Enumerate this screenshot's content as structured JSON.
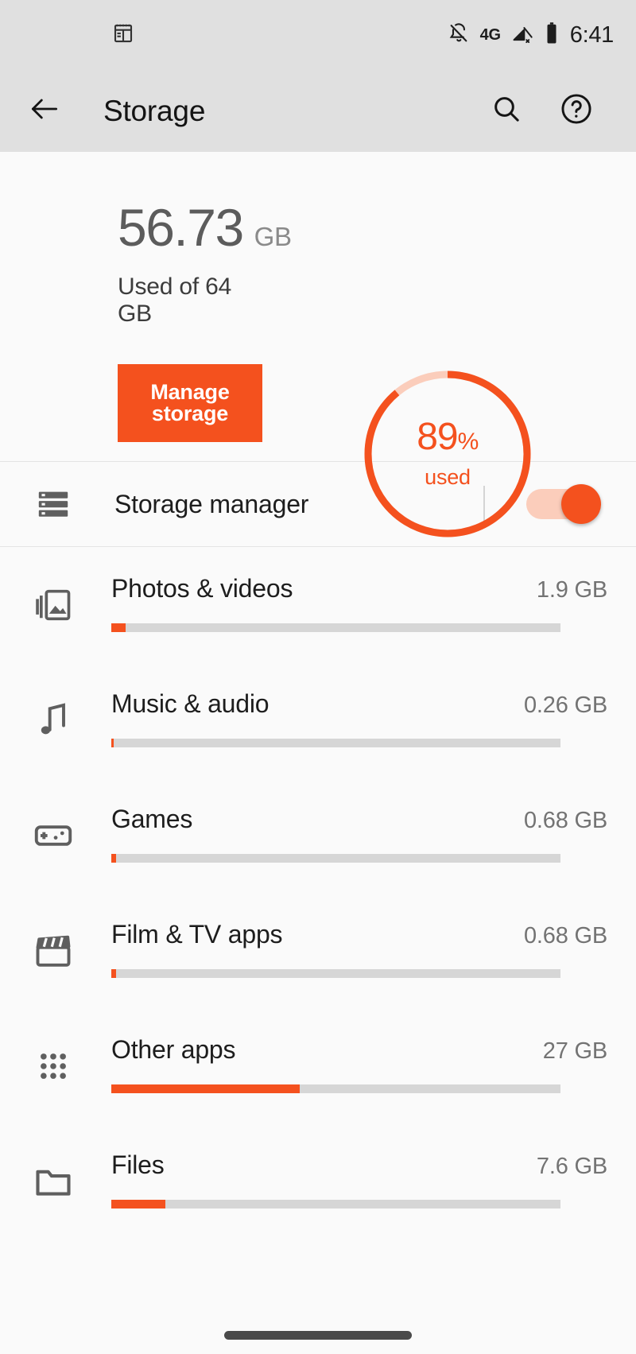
{
  "status_bar": {
    "left_icons": [
      "calendar-notepad-icon"
    ],
    "right_icons": [
      "bell-off-icon",
      "signal-off-icon",
      "battery-icon"
    ],
    "network": "4G",
    "time": "6:41"
  },
  "app_bar": {
    "back_icon": "arrow-back-icon",
    "title": "Storage",
    "search_icon": "search-icon",
    "help_icon": "help-circle-icon"
  },
  "summary": {
    "used_value": "56.73",
    "used_unit": "GB",
    "used_of": "Used of 64 GB",
    "manage_button": "Manage storage",
    "gauge_percent": "89",
    "gauge_percent_symbol": "%",
    "gauge_caption": "used",
    "gauge_fill_ratio": 0.89
  },
  "storage_manager": {
    "icon": "storage-server-icon",
    "label": "Storage manager",
    "toggle_state": "on"
  },
  "categories": [
    {
      "icon": "photos-videos-icon",
      "name": "Photos & videos",
      "size": "1.9 GB",
      "bar_ratio": 0.032
    },
    {
      "icon": "music-note-icon",
      "name": "Music & audio",
      "size": "0.26 GB",
      "bar_ratio": 0.004
    },
    {
      "icon": "gamepad-icon",
      "name": "Games",
      "size": "0.68 GB",
      "bar_ratio": 0.011
    },
    {
      "icon": "clapperboard-icon",
      "name": "Film & TV apps",
      "size": "0.68 GB",
      "bar_ratio": 0.011
    },
    {
      "icon": "apps-grid-icon",
      "name": "Other apps",
      "size": "27 GB",
      "bar_ratio": 0.42
    },
    {
      "icon": "folder-icon",
      "name": "Files",
      "size": "7.6 GB",
      "bar_ratio": 0.12
    }
  ],
  "colors": {
    "accent": "#f4511e",
    "accent_light": "#fbcdbb",
    "status_bar_bg": "#e0e0e0",
    "page_bg": "#fafafa",
    "track": "#d6d6d6",
    "text_primary": "#1d1d1d",
    "text_secondary": "#737373"
  },
  "navigation": {
    "pill": "gesture-nav-pill"
  },
  "chart_data": {
    "type": "bar",
    "title": "Storage usage by category",
    "categories": [
      "Photos & videos",
      "Music & audio",
      "Games",
      "Film & TV apps",
      "Other apps",
      "Files"
    ],
    "values": [
      1.9,
      0.26,
      0.68,
      0.68,
      27,
      7.6
    ],
    "unit": "GB",
    "total_capacity_gb": 64,
    "total_used_gb": 56.73,
    "used_percent": 89,
    "xlabel": "",
    "ylabel": "GB",
    "ylim": [
      0,
      64
    ]
  }
}
